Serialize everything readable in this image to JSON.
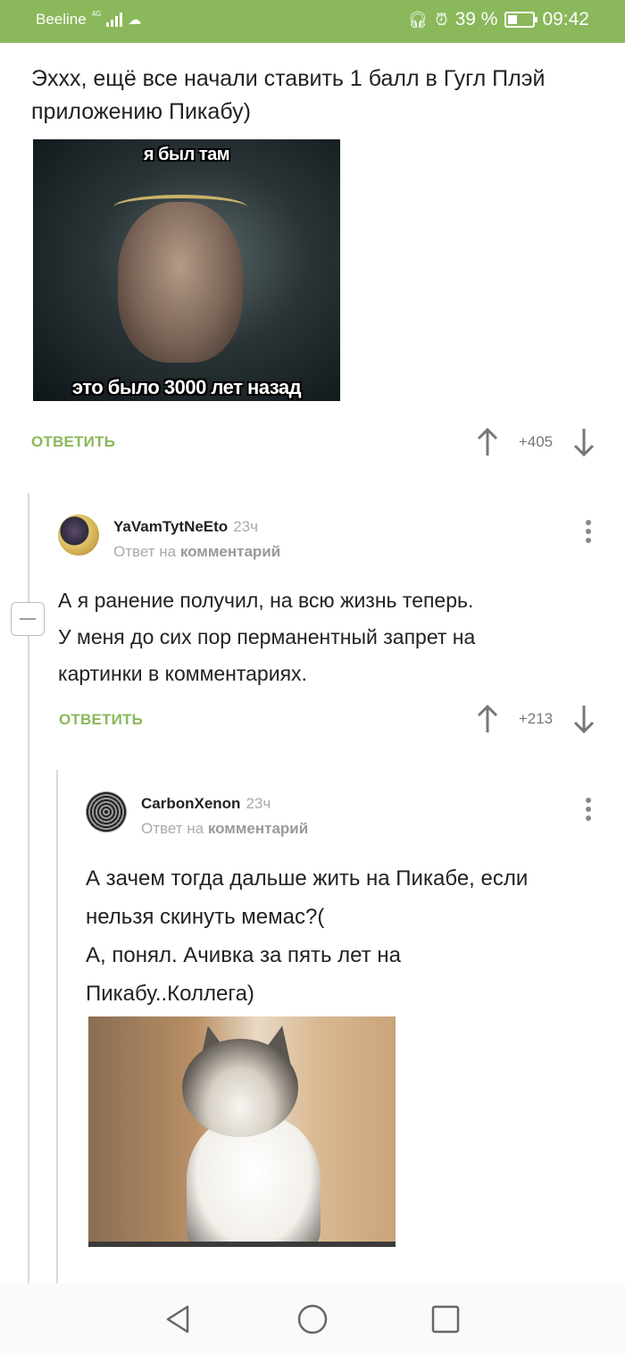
{
  "status_bar": {
    "carrier": "Beeline",
    "network": "4G",
    "battery_percent": "39 %",
    "battery_level": 0.39,
    "time": "09:42"
  },
  "post": {
    "text": "Эххх, ещё все начали ставить 1 балл в Гугл Плэй приложению Пикабу)",
    "image": {
      "caption_top": "я был там",
      "caption_bottom": "это было 3000 лет назад"
    },
    "reply_label": "ОТВЕТИТЬ",
    "score": "+405"
  },
  "comments": [
    {
      "username": "YaVamTytNeEto",
      "time": "23ч",
      "reply_prefix": "Ответ на",
      "reply_target": "комментарий",
      "text_lines": [
        "А я ранение получил, на всю жизнь теперь.",
        "У меня до сих пор перманентный запрет на",
        "картинки в комментариях."
      ],
      "reply_label": "ОТВЕТИТЬ",
      "score": "+213"
    },
    {
      "username": "CarbonXenon",
      "time": "23ч",
      "reply_prefix": "Ответ на",
      "reply_target": "комментарий",
      "text_lines": [
        "А зачем тогда дальше жить на Пикабе, если",
        "нельзя скинуть мемас?(",
        "А, понял. Ачивка за пять лет на",
        "Пикабу..Коллега)"
      ]
    }
  ],
  "colors": {
    "accent": "#8ab85a",
    "text": "#222222",
    "muted": "#aaaaaa"
  },
  "icons": {
    "upvote": "arrow-up-icon",
    "downvote": "arrow-down-icon",
    "menu": "kebab-menu-icon",
    "collapse": "minus-icon",
    "nav_back": "triangle-back-icon",
    "nav_home": "circle-home-icon",
    "nav_recent": "square-recent-icon"
  }
}
